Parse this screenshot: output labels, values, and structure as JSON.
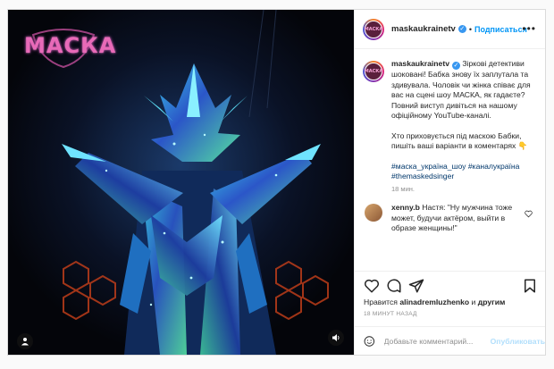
{
  "media": {
    "logo_text": "МАСКА"
  },
  "header": {
    "username": "maskaukrainetv",
    "avatar_text": "МАСКА",
    "separator": "•",
    "follow_label": "Подписаться",
    "more_label": "•••"
  },
  "caption": {
    "username": "maskaukrainetv",
    "paragraph1": "Зіркові детективи шоковані! Бабка знову їх заплутала та здивувала. Чоловік чи жінка співає для вас на сцені шоу МАСКА, як гадаєте?",
    "paragraph1b": "Повний виступ дивіться на нашому офіційному YouTube-каналі.",
    "paragraph2": "Хто приховується під маскою Бабки, пишіть ваші варіанти в коментарях 👇",
    "hashtags": "#маска_україна_шоу #каналукраїна #themaskedsinger",
    "time": "18 мин."
  },
  "comment": {
    "username": "xenny.b",
    "text": "Настя: \"Ну мужчина тоже может, будучи актёром, выйти в образе женщины!\""
  },
  "likes": {
    "prefix": "Нравится",
    "user": "alinadremluzhenko",
    "conj": "и",
    "others": "другим"
  },
  "posted_ago": "18 МИНУТ НАЗАД",
  "add_comment": {
    "placeholder": "Добавьте комментарий...",
    "publish_label": "Опубликовать"
  },
  "colors": {
    "accent": "#0095f6",
    "hashtag": "#00376b",
    "verified": "#3897f0",
    "publish_disabled": "#b2dffc"
  }
}
